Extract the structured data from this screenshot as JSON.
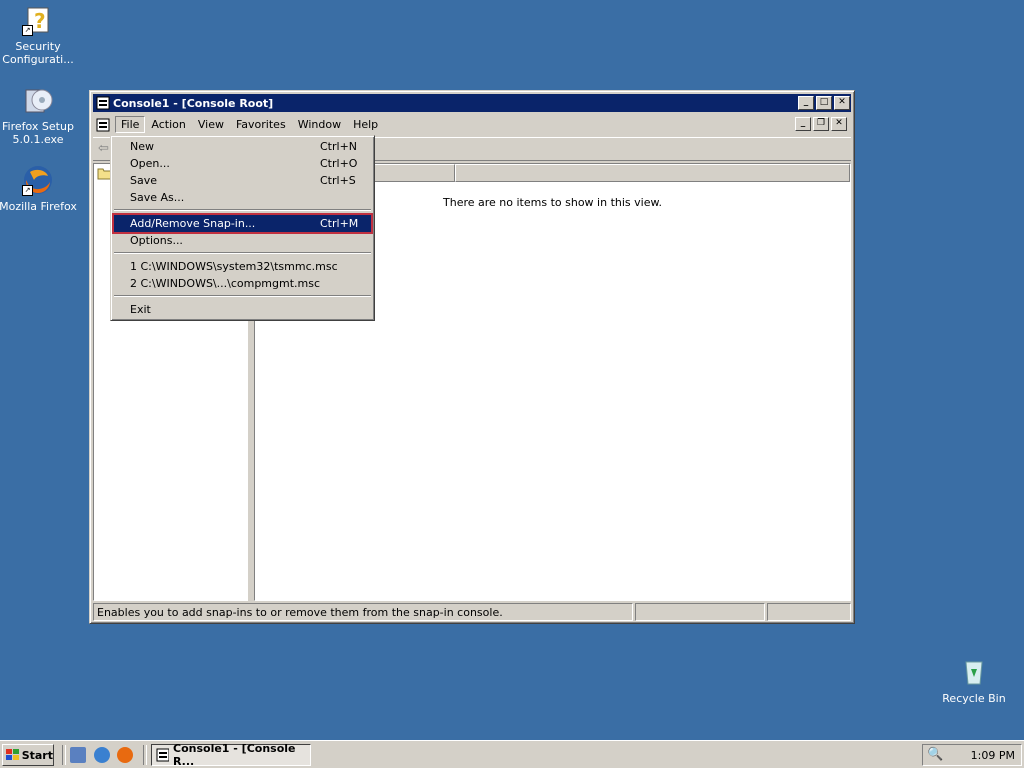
{
  "desktop": {
    "icons": [
      {
        "label": "Security Configurati..."
      },
      {
        "label": "Firefox Setup 5.0.1.exe"
      },
      {
        "label": "Mozilla Firefox"
      },
      {
        "label": "Recycle Bin"
      }
    ]
  },
  "window": {
    "title": "Console1 - [Console Root]",
    "menubar": [
      "File",
      "Action",
      "View",
      "Favorites",
      "Window",
      "Help"
    ],
    "list_empty_message": "There are no items to show in this view.",
    "status_text": "Enables you to add snap-ins to or remove them from the snap-in console."
  },
  "file_menu": {
    "items": [
      {
        "label": "New",
        "shortcut": "Ctrl+N"
      },
      {
        "label": "Open...",
        "shortcut": "Ctrl+O"
      },
      {
        "label": "Save",
        "shortcut": "Ctrl+S"
      },
      {
        "label": "Save As...",
        "shortcut": ""
      },
      {
        "label": "Add/Remove Snap-in...",
        "shortcut": "Ctrl+M"
      },
      {
        "label": "Options...",
        "shortcut": ""
      },
      {
        "label": "1 C:\\WINDOWS\\system32\\tsmmc.msc",
        "shortcut": ""
      },
      {
        "label": "2 C:\\WINDOWS\\...\\compmgmt.msc",
        "shortcut": ""
      },
      {
        "label": "Exit",
        "shortcut": ""
      }
    ]
  },
  "taskbar": {
    "start_label": "Start",
    "task_label": "Console1 - [Console R...",
    "clock": "1:09 PM"
  },
  "colors": {
    "desktop": "#3a6ea5",
    "titlebar": "#0a246a",
    "highlight": "#0a246a",
    "highlight_outline": "#c03040"
  }
}
